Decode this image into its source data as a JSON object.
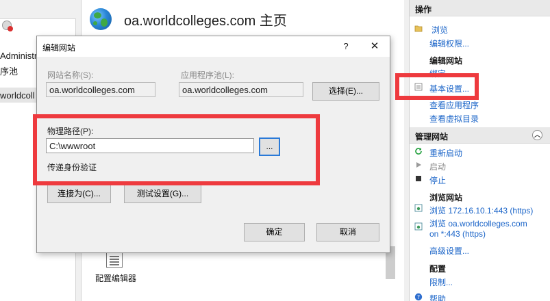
{
  "tree": {
    "items": [
      "Administrat",
      "序池",
      "worldcoll"
    ]
  },
  "center": {
    "page_title": "oa.worldcolleges.com 主页",
    "feature_label": "配置编辑器"
  },
  "actions": {
    "header": "操作",
    "browse": "浏览",
    "edit_permissions": "编辑权限...",
    "edit_site_heading": "编辑网站",
    "bindings": "绑定...",
    "basic_settings": "基本设置...",
    "view_apps": "查看应用程序",
    "view_vdirs": "查看虚拟目录",
    "manage_heading": "管理网站",
    "restart": "重新启动",
    "start": "启动",
    "stop": "停止",
    "browse_site_heading": "浏览网站",
    "browse_ip_line": "浏览 172.16.10.1:443 (https)",
    "browse_host_line1": "浏览 oa.worldcolleges.com",
    "browse_host_line2": "on *:443 (https)",
    "advanced_settings": "高级设置...",
    "config_heading": "配置",
    "limits": "限制...",
    "help": "帮助"
  },
  "dialog": {
    "title": "编辑网站",
    "help_glyph": "?",
    "close_glyph": "✕",
    "site_name_label": "网站名称(S):",
    "site_name_value": "oa.worldcolleges.com",
    "app_pool_label": "应用程序池(L):",
    "app_pool_value": "oa.worldcolleges.com",
    "select_button": "选择(E)...",
    "physical_path_label": "物理路径(P):",
    "physical_path_value": "C:\\wwwroot",
    "browse_button": "...",
    "pass_through_label": "传递身份验证",
    "connect_as_button": "连接为(C)...",
    "test_settings_button": "测试设置(G)...",
    "ok_button": "确定",
    "cancel_button": "取消"
  },
  "colors": {
    "highlight": "#ee3a3e",
    "link": "#1a64c8",
    "focus": "#2a7ad8"
  }
}
